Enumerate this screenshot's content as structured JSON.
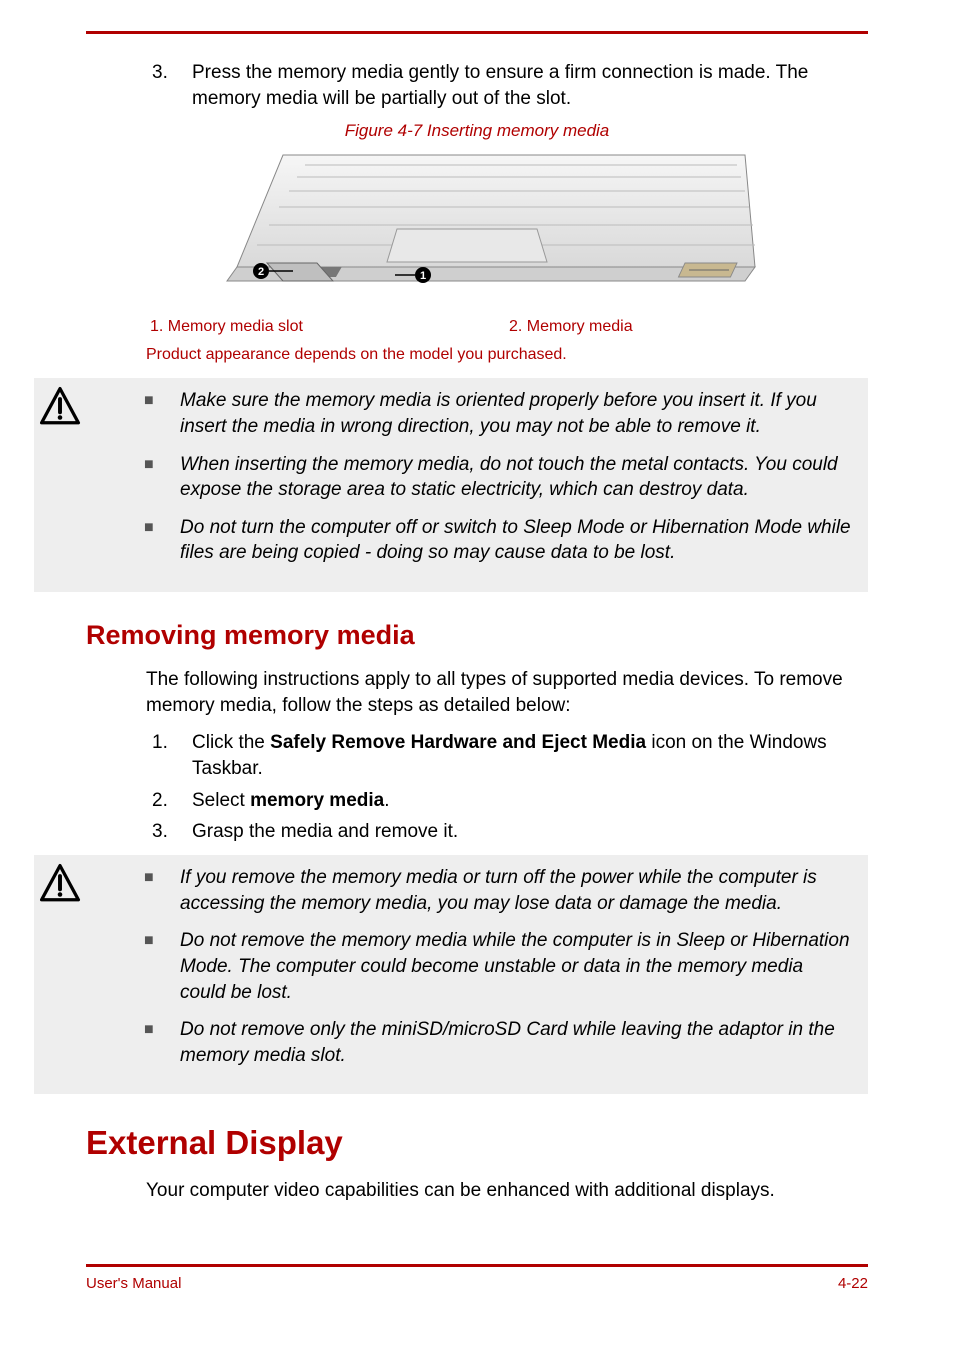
{
  "step3": {
    "num": "3.",
    "text": "Press the memory media gently to ensure a firm connection is made. The memory media will be partially out of the slot."
  },
  "figure": {
    "caption": "Figure 4-7 Inserting memory media",
    "legend1": "1. Memory media slot",
    "legend2": "2. Memory media",
    "note": "Product appearance depends on the model you purchased."
  },
  "warn1": {
    "b1": "Make sure the memory media is oriented properly before you insert it. If you insert the media in wrong direction, you may not be able to remove it.",
    "b2": "When inserting the memory media, do not touch the metal contacts. You could expose the storage area to static electricity, which can destroy data.",
    "b3": "Do not turn the computer off or switch to Sleep Mode or Hibernation Mode while files are being copied - doing so may cause data to be lost."
  },
  "removing": {
    "heading": "Removing memory media",
    "intro": "The following instructions apply to all types of supported media devices. To remove memory media, follow the steps as detailed below:",
    "s1": {
      "num": "1.",
      "pre": "Click the ",
      "bold": "Safely Remove Hardware and Eject Media",
      "post": " icon on the Windows Taskbar."
    },
    "s2": {
      "num": "2.",
      "pre": "Select ",
      "bold": "memory media",
      "post": "."
    },
    "s3": {
      "num": "3.",
      "text": "Grasp the media and remove it."
    }
  },
  "warn2": {
    "b1": "If you remove the memory media or turn off the power while the computer is accessing the memory media, you may lose data or damage the media.",
    "b2": "Do not remove the memory media while the computer is in Sleep or Hibernation Mode. The computer could become unstable or data in the memory media could be lost.",
    "b3": "Do not remove only the miniSD/microSD Card while leaving the adaptor in the memory media slot."
  },
  "external": {
    "heading": "External Display",
    "text": "Your computer video capabilities can be enhanced with additional displays."
  },
  "footer": {
    "left": "User's Manual",
    "right": "4-22"
  }
}
